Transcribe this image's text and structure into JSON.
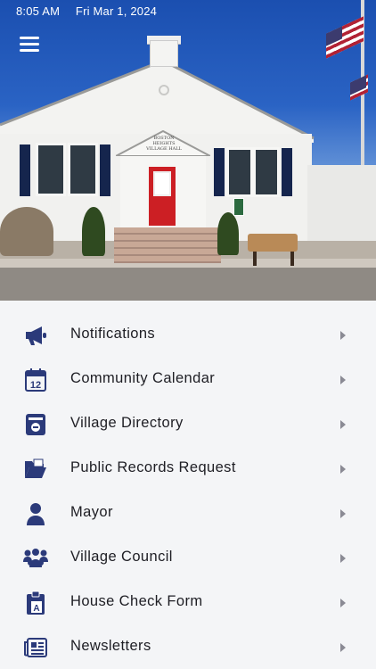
{
  "status_bar": {
    "time": "8:05 AM",
    "date": "Fri Mar 1, 2024"
  },
  "hero": {
    "building_sign": "BOSTON HEIGHTS VILLAGE HALL"
  },
  "colors": {
    "icon": "#2b3a7a",
    "accent_door": "#cc1f24",
    "background": "#f4f5f7"
  },
  "menu": {
    "items": [
      {
        "label": "Notifications",
        "icon": "megaphone-icon"
      },
      {
        "label": "Community Calendar",
        "icon": "calendar-icon"
      },
      {
        "label": "Village Directory",
        "icon": "phone-book-icon"
      },
      {
        "label": "Public Records Request",
        "icon": "folder-open-icon"
      },
      {
        "label": "Mayor",
        "icon": "person-icon"
      },
      {
        "label": "Village Council",
        "icon": "group-icon"
      },
      {
        "label": "House Check Form",
        "icon": "clipboard-icon"
      },
      {
        "label": "Newsletters",
        "icon": "newspaper-icon"
      }
    ]
  }
}
